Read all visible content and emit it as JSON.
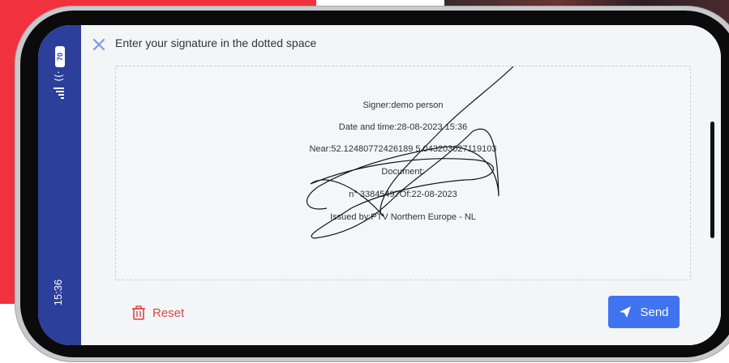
{
  "status": {
    "time": "15:36",
    "battery": "70"
  },
  "header": {
    "instruction": "Enter your signature in the dotted space"
  },
  "signature_box": {
    "lines": [
      "Signer:demo person",
      "Date and time:28-08-2023 15:36",
      "Near:52.12480772426189 5.043203027119103",
      "Document:",
      "n° 33845497Of:22-08-2023",
      "Issued by:PTV Northern Europe - NL"
    ]
  },
  "actions": {
    "reset_label": "Reset",
    "send_label": "Send"
  },
  "colors": {
    "status_bar": "#2b3f9b",
    "accent": "#3f73f0",
    "danger": "#d94545",
    "background_brand": "#f0323e"
  }
}
